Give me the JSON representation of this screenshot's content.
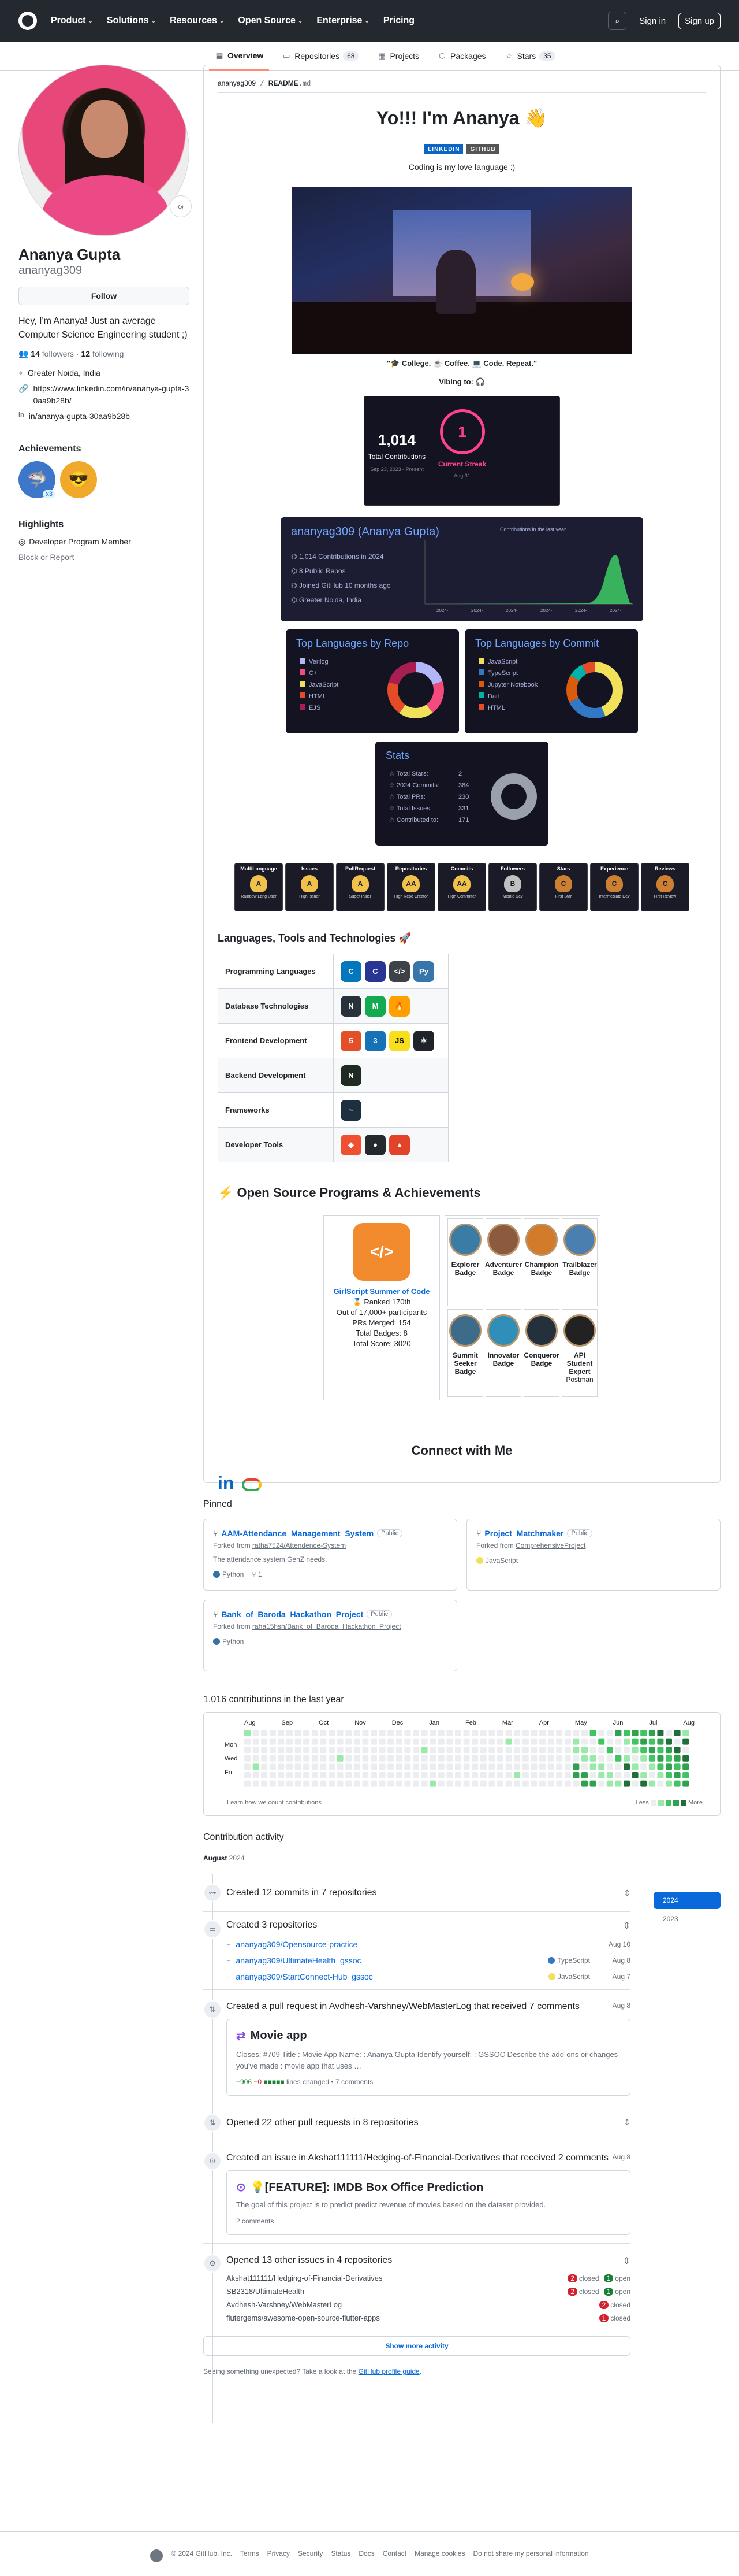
{
  "nav": {
    "items": [
      "Product",
      "Solutions",
      "Resources",
      "Open Source",
      "Enterprise",
      "Pricing"
    ],
    "signin": "Sign in",
    "signup": "Sign up"
  },
  "tabs": [
    {
      "label": "Overview",
      "icon": "book-icon"
    },
    {
      "label": "Repositories",
      "count": "68",
      "icon": "repo-icon"
    },
    {
      "label": "Projects",
      "icon": "table-icon"
    },
    {
      "label": "Packages",
      "icon": "package-icon"
    },
    {
      "label": "Stars",
      "count": "35",
      "icon": "star-icon"
    }
  ],
  "profile": {
    "name": "Ananya Gupta",
    "login": "ananyag309",
    "follow": "Follow",
    "bio": "Hey, I'm Ananya! Just an average Computer Science Engineering student ;)",
    "followers": "14",
    "followers_label": "followers",
    "following": "12",
    "following_label": "following",
    "location": "Greater Noida, India",
    "link": "https://www.linkedin.com/in/ananya-gupta-30aa9b28b/",
    "linkedin": "in/ananya-gupta-30aa9b28b",
    "achievements_title": "Achievements",
    "achievement_count": "x3",
    "highlights_title": "Highlights",
    "highlight": "Developer Program Member",
    "pro": "PRO",
    "block": "Block or Report"
  },
  "readme": {
    "path_user": "ananyag309",
    "path_sep": " / ",
    "path_file": "README",
    "path_ext": ".md",
    "heading": "Yo!!! I'm Ananya 👋",
    "badge_linkedin": "LINKEDIN",
    "badge_github": "GITHUB",
    "tagline": "Coding is my love language :)",
    "caption": "\"🎓 College. ☕ Coffee. 💻 Code. Repeat.\"",
    "vibing": "Vibing to: 🎧",
    "streak": {
      "total": "1,014",
      "total_label": "Total Contributions",
      "total_range": "Sep 23, 2023 - Present",
      "current": "1",
      "current_label": "Current Streak",
      "current_date": "Aug 31",
      "longest": "",
      "longest_label": ""
    },
    "activity": {
      "title": "ananyag309 (Ananya Gupta)",
      "contrib": "1,014 Contributions in 2024",
      "repos": "8 Public Repos",
      "joined": "Joined GitHub 10 months ago",
      "location": "Greater Noida, India",
      "chart_title": "Contributions in the last year",
      "x_labels": [
        "2024-",
        "2024-",
        "2024-",
        "2024-",
        "2024-",
        "2024-"
      ]
    },
    "langs_repo": {
      "title": "Top Languages by Repo",
      "items": [
        {
          "name": "Verilog",
          "color": "#b2b7f8"
        },
        {
          "name": "C++",
          "color": "#f34b7d"
        },
        {
          "name": "JavaScript",
          "color": "#f1e05a"
        },
        {
          "name": "HTML",
          "color": "#e34c26"
        },
        {
          "name": "EJS",
          "color": "#a91e50"
        }
      ]
    },
    "langs_commit": {
      "title": "Top Languages by Commit",
      "items": [
        {
          "name": "JavaScript",
          "color": "#f1e05a"
        },
        {
          "name": "TypeScript",
          "color": "#3178c6"
        },
        {
          "name": "Jupyter Notebook",
          "color": "#da5b0b"
        },
        {
          "name": "Dart",
          "color": "#00b4ab"
        },
        {
          "name": "HTML",
          "color": "#e34c26"
        }
      ]
    },
    "stats": {
      "title": "Stats",
      "rows": [
        {
          "label": "Total Stars:",
          "value": "2"
        },
        {
          "label": "2024 Commits:",
          "value": "384"
        },
        {
          "label": "Total PRs:",
          "value": "230"
        },
        {
          "label": "Total Issues:",
          "value": "331"
        },
        {
          "label": "Contributed to:",
          "value": "171"
        }
      ]
    },
    "trophies": [
      {
        "title": "MultiLanguage",
        "rank": "A",
        "sub": "Rainbow Lang User",
        "color": "#f0c14b"
      },
      {
        "title": "Issues",
        "rank": "A",
        "sub": "High Issuer",
        "color": "#f0c14b"
      },
      {
        "title": "PullRequest",
        "rank": "A",
        "sub": "Super Puller",
        "color": "#f0c14b"
      },
      {
        "title": "Repositories",
        "rank": "AA",
        "sub": "High Repo Creator",
        "color": "#f0c14b"
      },
      {
        "title": "Commits",
        "rank": "AA",
        "sub": "High Committer",
        "color": "#f0c14b"
      },
      {
        "title": "Followers",
        "rank": "B",
        "sub": "Middle Dev",
        "color": "#c0c0c0"
      },
      {
        "title": "Stars",
        "rank": "C",
        "sub": "First Star",
        "color": "#cd7f32"
      },
      {
        "title": "Experience",
        "rank": "C",
        "sub": "Intermediate Dev",
        "color": "#cd7f32"
      },
      {
        "title": "Reviews",
        "rank": "C",
        "sub": "First Review",
        "color": "#cd7f32"
      }
    ],
    "tools_title": "Languages, Tools and Technologies 🚀",
    "tools": [
      {
        "label": "Programming Languages",
        "icons": [
          {
            "t": "C",
            "c": "#0277bd"
          },
          {
            "t": "C",
            "c": "#283593"
          },
          {
            "t": "</>",
            "c": "#3d4148"
          },
          {
            "t": "Py",
            "c": "#3776ab"
          }
        ]
      },
      {
        "label": "Database Technologies",
        "icons": [
          {
            "t": "N",
            "c": "#29313a"
          },
          {
            "t": "M",
            "c": "#13aa52"
          },
          {
            "t": "🔥",
            "c": "#ffa000"
          }
        ]
      },
      {
        "label": "Frontend Development",
        "icons": [
          {
            "t": "5",
            "c": "#e34f26"
          },
          {
            "t": "3",
            "c": "#1572b6"
          },
          {
            "t": "JS",
            "c": "#f7df1e"
          },
          {
            "t": "⚛",
            "c": "#20232a"
          }
        ]
      },
      {
        "label": "Backend Development",
        "icons": [
          {
            "t": "N",
            "c": "#1e2a22"
          }
        ]
      },
      {
        "label": "Frameworks",
        "icons": [
          {
            "t": "~",
            "c": "#1e2f3f"
          }
        ]
      },
      {
        "label": "Developer Tools",
        "icons": [
          {
            "t": "◆",
            "c": "#f05032"
          },
          {
            "t": "●",
            "c": "#24292f"
          },
          {
            "t": "▲",
            "c": "#e24329"
          }
        ]
      }
    ],
    "oss_title": "⚡ Open Source Programs & Achievements",
    "gssoc": {
      "link": "GirlScript Summer of Code",
      "rank": "🏅 Ranked 170th",
      "out_of": "Out of 17,000+ participants",
      "prs": "PRs Merged: 154",
      "badges": "Total Badges: 8",
      "score": "Total Score: 3020"
    },
    "oss_badges": [
      {
        "name": "Explorer Badge",
        "color": "#3a7ca5"
      },
      {
        "name": "Adventurer Badge",
        "color": "#8c5a3c"
      },
      {
        "name": "Champion Badge",
        "color": "#d27b2a"
      },
      {
        "name": "Trailblazer Badge",
        "color": "#4a7fb0"
      },
      {
        "name": "Summit Seeker Badge",
        "color": "#3d6b8a"
      },
      {
        "name": "Innovator Badge",
        "color": "#2f8fb8"
      },
      {
        "name": "Conqueror Badge",
        "color": "#24313d"
      },
      {
        "name": "API Student Expert",
        "sub": "Postman",
        "color": "#222222"
      }
    ],
    "connect_title": "Connect with Me"
  },
  "pinned": {
    "title": "Pinned",
    "items": [
      {
        "name": "AAM-Attendance_Management_System",
        "vis": "Public",
        "fork_prefix": "Forked from ",
        "fork": "ratha7524/Attendence-System",
        "desc": "The attendance system GenZ needs.",
        "lang": "Python",
        "lang_color": "#3572A5",
        "forks": "1"
      },
      {
        "name": "Project_Matchmaker",
        "vis": "Public",
        "fork_prefix": "Forked from ",
        "fork": "ComprehensiveProject",
        "desc": "",
        "lang": "JavaScript",
        "lang_color": "#f1e05a",
        "forks": ""
      },
      {
        "name": "Bank_of_Baroda_Hackathon_Project",
        "vis": "Public",
        "fork_prefix": "Forked from ",
        "fork": "raha15hsn/Bank_of_Baroda_Hackathon_Project",
        "desc": "",
        "lang": "Python",
        "lang_color": "#3572A5",
        "forks": ""
      }
    ]
  },
  "contributions": {
    "title": "1,016 contributions in the last year",
    "months": [
      "Aug",
      "Sep",
      "Oct",
      "Nov",
      "Dec",
      "Jan",
      "Feb",
      "Mar",
      "Apr",
      "May",
      "Jun",
      "Jul",
      "Aug"
    ],
    "days": [
      "Mon",
      "Wed",
      "Fri"
    ],
    "learn": "Learn how we count contributions",
    "less": "Less",
    "more": "More",
    "years": [
      "2024",
      "2023"
    ]
  },
  "activity": {
    "title": "Contribution activity",
    "month": "August",
    "year": "2024",
    "commits": "Created 12 commits in 7 repositories",
    "repos_title": "Created 3 repositories",
    "repos": [
      {
        "name": "ananyag309/Opensource-practice",
        "lang": "",
        "date": "Aug 10"
      },
      {
        "name": "ananyag309/UltimateHealth_gssoc",
        "lang": "TypeScript",
        "color": "#3178c6",
        "date": "Aug 8"
      },
      {
        "name": "ananyag309/StartConnect-Hub_gssoc",
        "lang": "JavaScript",
        "color": "#f1e05a",
        "date": "Aug 7"
      }
    ],
    "pr_prefix": "Created a pull request in ",
    "pr_repo": "Avdhesh-Varshney/WebMasterLog",
    "pr_suffix": " that received 7 comments",
    "pr_date": "Aug 8",
    "pr_title": "Movie app",
    "pr_body": "Closes: #709 Title : Movie App Name: : Ananya Gupta Identify yourself: : GSSOC Describe the add-ons or changes you've made : movie app that uses …",
    "pr_add": "+906",
    "pr_del": "−0",
    "pr_lines": "lines changed",
    "pr_comments": "• 7 comments",
    "opened_prs": "Opened 22 other pull requests in 8 repositories",
    "issue_prefix": "Created an issue in ",
    "issue_repo": "Akshat111111/Hedging-of-Financial-Derivatives",
    "issue_suffix": " that received 2 comments",
    "issue_date": "Aug 8",
    "issue_title": "💡[FEATURE]: IMDB Box Office Prediction",
    "issue_body": "The goal of this project is to predict predict revenue of movies based on the dataset provided.",
    "issue_comments": "2 comments",
    "opened_issues": "Opened 13 other issues in 4 repositories",
    "issue_repos": [
      {
        "name": "Akshat111111/Hedging-of-Financial-Derivatives",
        "closed": "2",
        "open": "1"
      },
      {
        "name": "SB2318/UltimateHealth",
        "closed": "2",
        "open": "1"
      },
      {
        "name": "Avdhesh-Varshney/WebMasterLog",
        "closed": "2",
        "open": ""
      },
      {
        "name": "flutergems/awesome-open-source-flutter-apps",
        "closed": "1",
        "open": ""
      }
    ],
    "closed_label": "closed",
    "open_label": "open",
    "show_more": "Show more activity",
    "unexpected": "Seeing something unexpected? Take a look at the ",
    "guide": "GitHub profile guide",
    "period": "."
  },
  "footer": {
    "copy": "© 2024 GitHub, Inc.",
    "links": [
      "Terms",
      "Privacy",
      "Security",
      "Status",
      "Docs",
      "Contact",
      "Manage cookies",
      "Do not share my personal information"
    ]
  }
}
